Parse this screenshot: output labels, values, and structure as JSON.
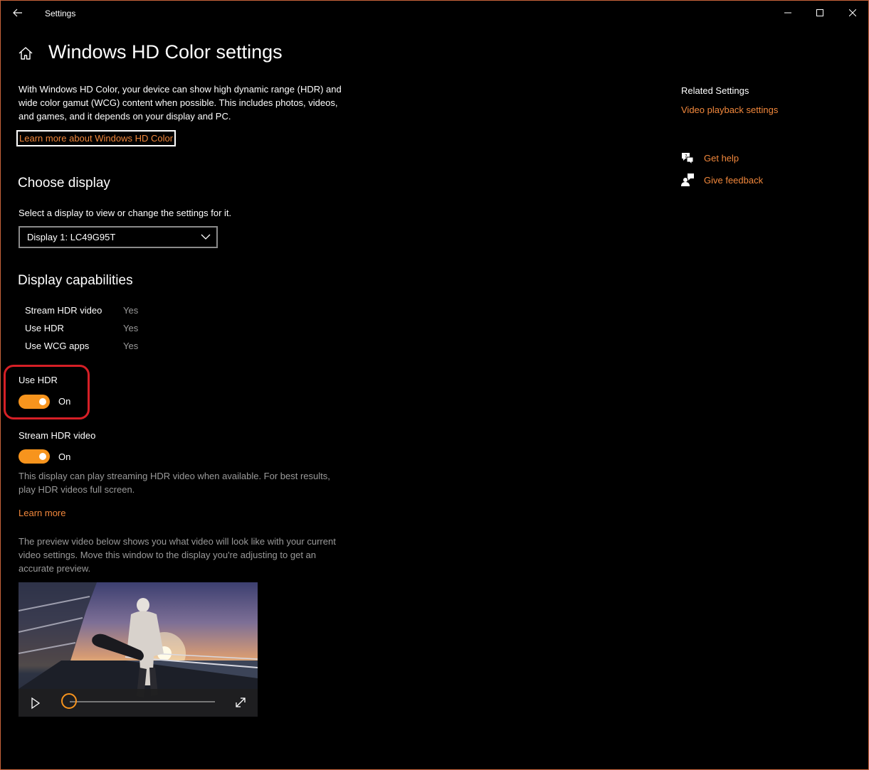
{
  "window": {
    "title": "Settings"
  },
  "header": {
    "page_title": "Windows HD Color settings"
  },
  "intro": {
    "text": "With Windows HD Color, your device can show high dynamic range (HDR) and wide color gamut (WCG) content when possible. This includes photos, videos, and games, and it depends on your display and PC.",
    "learn_link": "Learn more about Windows HD Color"
  },
  "choose_display": {
    "heading": "Choose display",
    "label": "Select a display to view or change the settings for it.",
    "selected": "Display 1: LC49G95T"
  },
  "capabilities": {
    "heading": "Display capabilities",
    "rows": [
      {
        "name": "Stream HDR video",
        "value": "Yes"
      },
      {
        "name": "Use HDR",
        "value": "Yes"
      },
      {
        "name": "Use WCG apps",
        "value": "Yes"
      }
    ]
  },
  "use_hdr": {
    "label": "Use HDR",
    "state": "On",
    "on": true
  },
  "stream_hdr": {
    "label": "Stream HDR video",
    "state": "On",
    "on": true,
    "note": "This display can play streaming HDR video when available. For best results, play HDR videos full screen.",
    "learn_more": "Learn more"
  },
  "preview": {
    "note": "The preview video below shows you what video will look like with your current video settings. Move this window to the display you're adjusting to get an accurate preview.",
    "progress": 0
  },
  "side_panel": {
    "related_title": "Related Settings",
    "related_link": "Video playback settings",
    "get_help": "Get help",
    "give_feedback": "Give feedback"
  },
  "colors": {
    "accent": "#f7941d",
    "link": "#f2883c",
    "highlight": "#d61f26"
  }
}
